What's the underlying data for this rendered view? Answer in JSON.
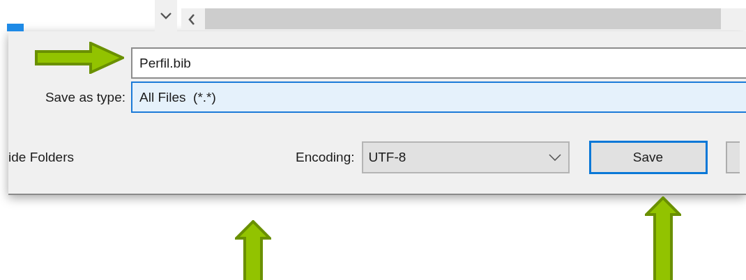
{
  "file_name": {
    "value": "Perfil.bib"
  },
  "save_as_type": {
    "label": "Save as type:",
    "value": "All Files  (*.*)",
    "focused": true
  },
  "hide_folders": "ide Folders",
  "encoding": {
    "label": "Encoding:",
    "value": "UTF-8"
  },
  "buttons": [
    {
      "label": "Save",
      "default": true
    }
  ],
  "annotations": [
    {
      "kind": "right"
    },
    {
      "kind": "up"
    },
    {
      "kind": "up"
    }
  ]
}
